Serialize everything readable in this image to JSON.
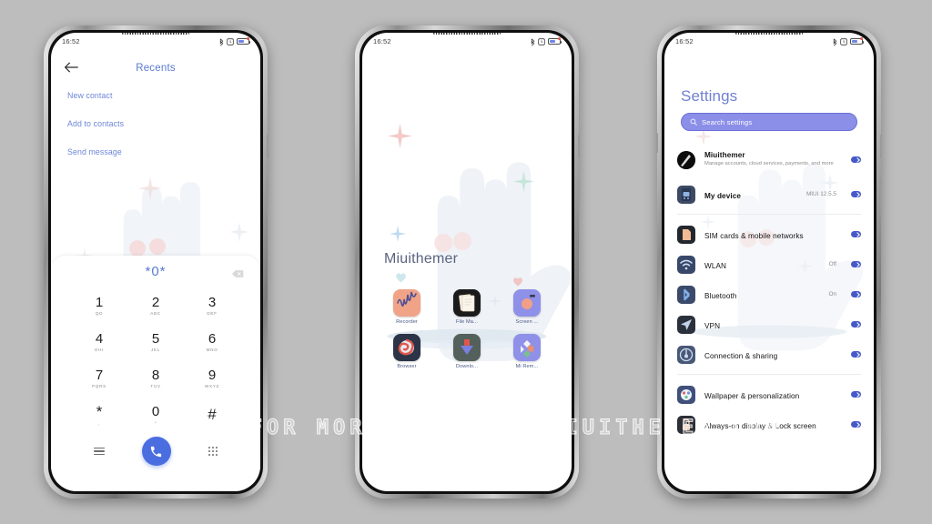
{
  "background_color": "#bdbdbd",
  "watermark": "VISIT FOR MORE THEMES - MIUITHEMER.COM",
  "theme": {
    "accent_blue": "#5b7bd0",
    "search_bar": "#8b8fe8",
    "call_button": "#4a6ee0",
    "chevron_badge": "#4559c8"
  },
  "status_bar": {
    "time": "16:52",
    "icons": [
      "bluetooth-icon",
      "alarm-icon",
      "battery-icon"
    ]
  },
  "phone1_dialer": {
    "back_icon": "back-arrow-icon",
    "title": "Recents",
    "actions": [
      "New contact",
      "Add to contacts",
      "Send message"
    ],
    "dialed_number": "*0*",
    "backspace_icon": "backspace-icon",
    "keys": [
      {
        "num": "1",
        "sub": "QD"
      },
      {
        "num": "2",
        "sub": "ABC"
      },
      {
        "num": "3",
        "sub": "DEF"
      },
      {
        "num": "4",
        "sub": "GHI"
      },
      {
        "num": "5",
        "sub": "JKL"
      },
      {
        "num": "6",
        "sub": "MNO"
      },
      {
        "num": "7",
        "sub": "PQRS"
      },
      {
        "num": "8",
        "sub": "TUV"
      },
      {
        "num": "9",
        "sub": "WXYZ"
      },
      {
        "num": "*",
        "sub": ","
      },
      {
        "num": "0",
        "sub": "+"
      },
      {
        "num": "#",
        "sub": ""
      }
    ],
    "bottom_bar": {
      "menu_icon": "menu-icon",
      "call_icon": "phone-call-icon",
      "keypad_icon": "keypad-grid-icon"
    }
  },
  "phone2_home": {
    "widget_label": "Miuithemer",
    "apps": [
      {
        "name": "Recorder",
        "icon": "recorder-icon",
        "bg": "#f0a387"
      },
      {
        "name": "File Ma...",
        "icon": "file-manager-icon",
        "bg": "#1b1b1b"
      },
      {
        "name": "Screen ...",
        "icon": "screen-recorder-icon",
        "bg": "#8f90e8"
      },
      {
        "name": "Browser",
        "icon": "browser-icon",
        "bg": "#2c3448"
      },
      {
        "name": "Downlo...",
        "icon": "downloads-icon",
        "bg": "#53605c"
      },
      {
        "name": "Mi Rem...",
        "icon": "mi-remote-icon",
        "bg": "#8f90e8"
      }
    ]
  },
  "phone3_settings": {
    "title": "Settings",
    "search": {
      "icon": "search-icon",
      "placeholder": "Search settings"
    },
    "groups": [
      {
        "rows": [
          {
            "label": "Miuithemer",
            "sub": "Manage accounts, cloud services, payments, and more",
            "value": "",
            "icon": "account-avatar-icon",
            "icon_type": "avatar"
          },
          {
            "label": "My device",
            "sub": "",
            "value": "MIUI 12.5.5",
            "icon": "my-device-icon",
            "icon_type": "device"
          }
        ]
      },
      {
        "rows": [
          {
            "label": "SIM cards & mobile networks",
            "sub": "",
            "value": "",
            "icon": "sim-card-icon",
            "icon_type": "sim"
          },
          {
            "label": "WLAN",
            "sub": "",
            "value": "Off",
            "icon": "wifi-icon",
            "icon_type": "wifi"
          },
          {
            "label": "Bluetooth",
            "sub": "",
            "value": "On",
            "icon": "bluetooth-icon",
            "icon_type": "bt"
          },
          {
            "label": "VPN",
            "sub": "",
            "value": "",
            "icon": "vpn-icon",
            "icon_type": "vpn"
          },
          {
            "label": "Connection & sharing",
            "sub": "",
            "value": "",
            "icon": "connection-sharing-icon",
            "icon_type": "share"
          }
        ]
      },
      {
        "rows": [
          {
            "label": "Wallpaper & personalization",
            "sub": "",
            "value": "",
            "icon": "wallpaper-icon",
            "icon_type": "wall"
          },
          {
            "label": "Always-on display & Lock screen",
            "sub": "",
            "value": "",
            "icon": "lock-screen-icon",
            "icon_type": "lock"
          }
        ]
      }
    ]
  }
}
